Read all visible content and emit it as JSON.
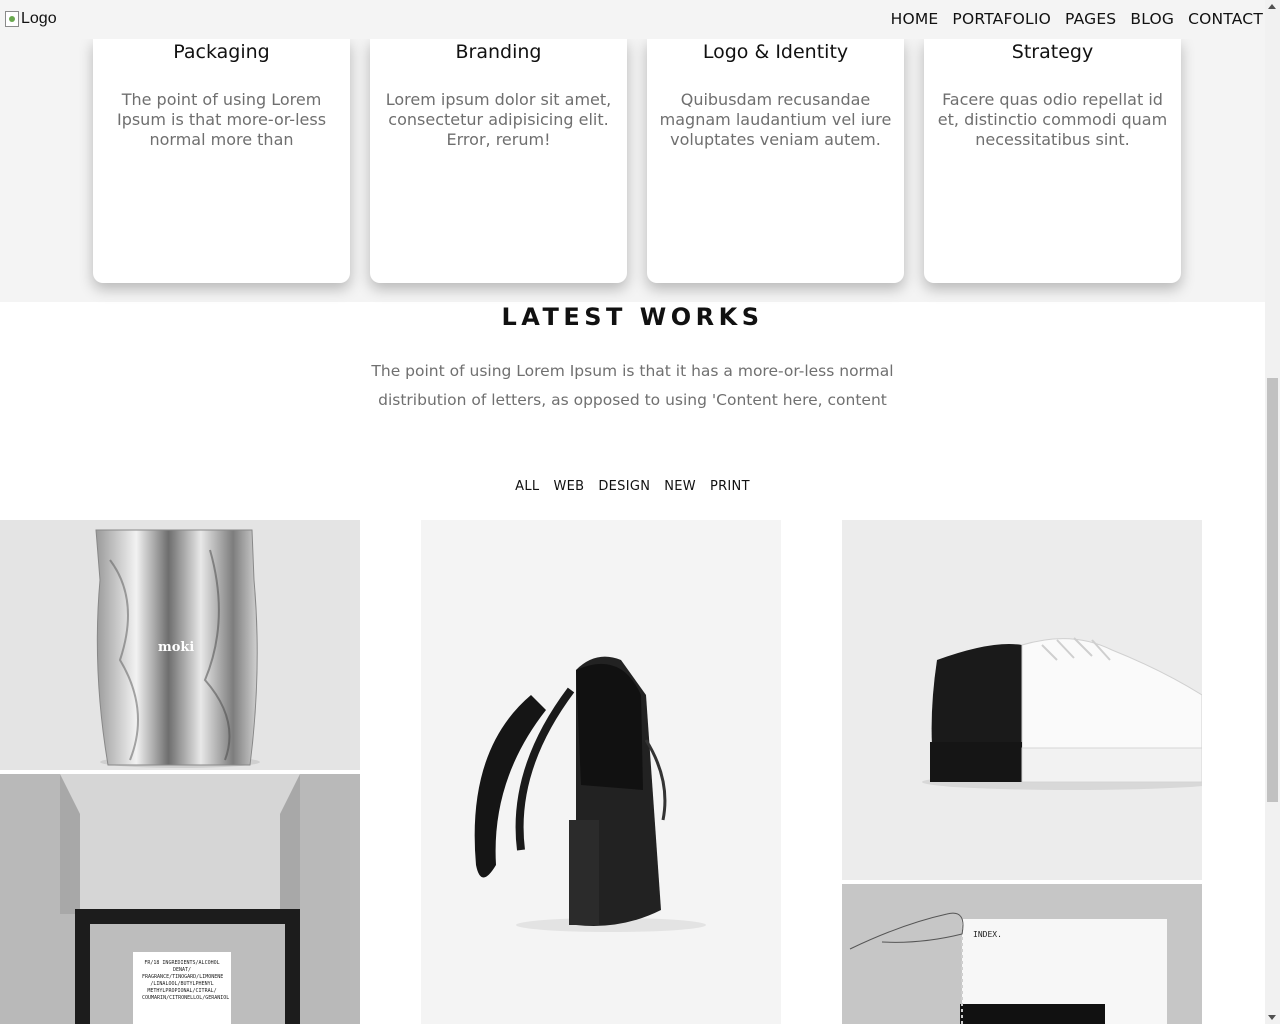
{
  "header": {
    "logo_alt": "Logo",
    "nav": [
      "HOME",
      "PORTAFOLIO",
      "PAGES",
      "BLOG",
      "CONTACT"
    ]
  },
  "services": [
    {
      "title": "Packaging",
      "text": "The point of using Lorem Ipsum is that more-or-less normal more than"
    },
    {
      "title": "Branding",
      "text": "Lorem ipsum dolor sit amet, consectetur adipisicing elit. Error, rerum!"
    },
    {
      "title": "Logo & Identity",
      "text": "Quibusdam recusandae magnam laudantium vel iure voluptates veniam autem."
    },
    {
      "title": "Strategy",
      "text": "Facere quas odio repellat id et, distinctio commodi quam necessitatibus sint."
    }
  ],
  "latest": {
    "title": "LATEST WORKS",
    "description": "The point of using Lorem Ipsum is that it has a more-or-less normal distribution of letters, as opposed to using 'Content here, content",
    "filters": [
      "ALL",
      "WEB",
      "DESIGN",
      "NEW",
      "PRINT"
    ]
  },
  "gallery": {
    "bag_label": "moki",
    "box_label": "FR/18 INGREDIENTS/ALCOHOL DENAT/ FRAGRANCE/TINOGARD/LIMONENE /LINALOOL/BUTYLPHENYL METHYLPROPIONAL/CITRAL/ COUMARIN/CITRONELLOL/GERANIOL",
    "book_label": "INDEX."
  }
}
